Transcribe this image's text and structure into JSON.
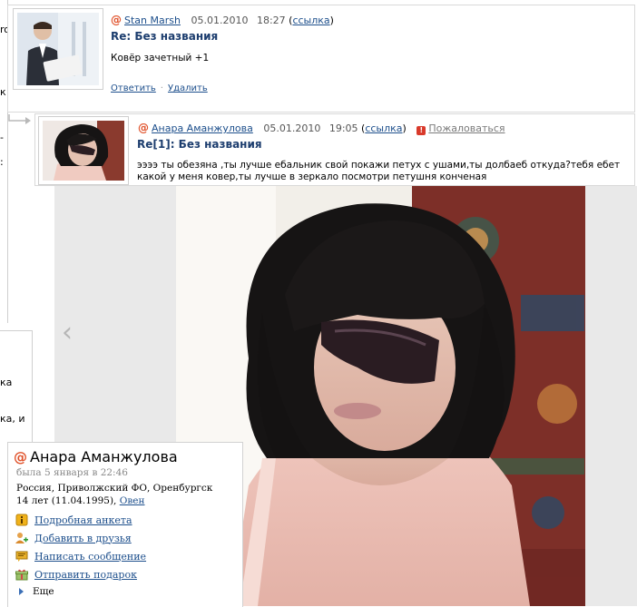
{
  "background": {
    "left_fragments": [
      "ro",
      "к",
      "-",
      ":",
      "ка",
      "ка, и"
    ]
  },
  "comments": [
    {
      "author": "Stan Marsh",
      "date": "05.01.2010",
      "time": "18:27",
      "link_label": "ссылка",
      "title": "Re: Без названия",
      "text": "Ковёр зачетный +1",
      "actions": {
        "reply": "Ответить",
        "delete": "Удалить"
      }
    },
    {
      "author": "Анара Аманжулова",
      "date": "05.01.2010",
      "time": "19:05",
      "link_label": "ссылка",
      "complain": "Пожаловаться",
      "title": "Re[1]: Без названия",
      "text": "ээээ ты обезяна ,ты лучше ебальник свой покажи петух с ушами,ты долбаеб откуда?тебя ебет какой у меня ковер,ты лучше в зеркало посмотри петушня конченая"
    }
  ],
  "profile": {
    "name": "Анара Аманжулова",
    "last_seen": "была 5 января в 22:46",
    "location": "Россия, Приволжский ФО, Оренбургск",
    "age": "14 лет (11.04.1995),",
    "zodiac": "Овен",
    "menu": [
      {
        "label": "Подробная анкета",
        "icon": "info-icon"
      },
      {
        "label": "Добавить в друзья",
        "icon": "add-friend-icon"
      },
      {
        "label": "Написать сообщение",
        "icon": "message-icon"
      },
      {
        "label": "Отправить подарок",
        "icon": "gift-icon"
      }
    ],
    "more": "Еще"
  },
  "colors": {
    "link": "#1d4f8c",
    "at_sign": "#e0522b",
    "warn": "#d93a2b",
    "viewer_bg": "#e9e9e9"
  }
}
